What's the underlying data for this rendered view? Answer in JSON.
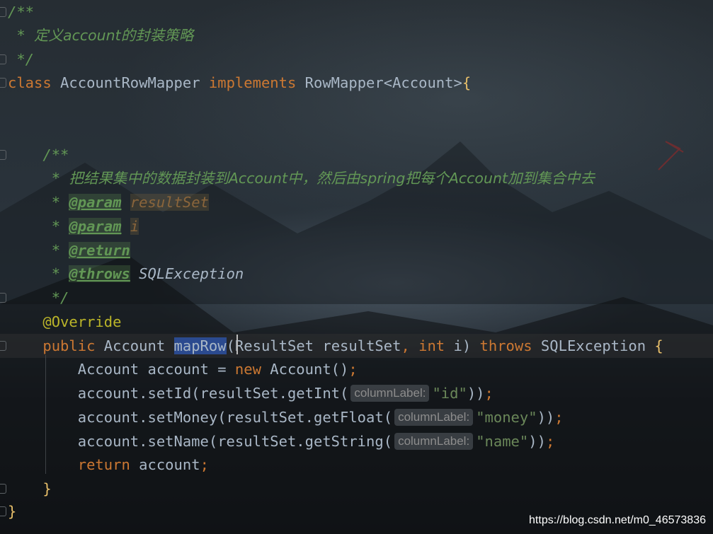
{
  "editor": {
    "lines": [
      {
        "id": "l1",
        "tokens": [
          {
            "t": "/**",
            "k": "c"
          }
        ]
      },
      {
        "id": "l2",
        "tokens": [
          {
            "t": " * ",
            "k": "c"
          },
          {
            "t": "定义account的封装策略",
            "k": "cn"
          }
        ]
      },
      {
        "id": "l3",
        "tokens": [
          {
            "t": " */",
            "k": "c"
          }
        ]
      },
      {
        "id": "l4",
        "tokens": [
          {
            "t": "class",
            "k": "kw"
          },
          {
            "t": " AccountRowMapper ",
            "k": ""
          },
          {
            "t": "implements",
            "k": "kw"
          },
          {
            "t": " RowMapper<Account>",
            "k": ""
          },
          {
            "t": "{",
            "k": "br"
          }
        ]
      },
      {
        "id": "l5",
        "tokens": []
      },
      {
        "id": "l6",
        "tokens": []
      },
      {
        "id": "l7",
        "tokens": [
          {
            "t": "    /**",
            "k": "c"
          }
        ]
      },
      {
        "id": "l8",
        "tokens": [
          {
            "t": "     * ",
            "k": "c"
          },
          {
            "t": "把结果集中的数据封装到Account中，然后由spring把每个Account加到集合中去",
            "k": "cn"
          }
        ]
      },
      {
        "id": "l9",
        "tokens": [
          {
            "t": "     * ",
            "k": "c"
          },
          {
            "t": "@param",
            "k": "tag"
          },
          {
            "t": " ",
            "k": "c"
          },
          {
            "t": "resultSet",
            "k": "pname"
          }
        ]
      },
      {
        "id": "l10",
        "tokens": [
          {
            "t": "     * ",
            "k": "c"
          },
          {
            "t": "@param",
            "k": "tag"
          },
          {
            "t": " ",
            "k": "c"
          },
          {
            "t": "i",
            "k": "pname"
          }
        ]
      },
      {
        "id": "l11",
        "tokens": [
          {
            "t": "     * ",
            "k": "c"
          },
          {
            "t": "@return",
            "k": "tag"
          }
        ]
      },
      {
        "id": "l12",
        "tokens": [
          {
            "t": "     * ",
            "k": "c"
          },
          {
            "t": "@throws",
            "k": "tag"
          },
          {
            "t": " SQLException",
            "k": "exc"
          }
        ]
      },
      {
        "id": "l13",
        "tokens": [
          {
            "t": "     */",
            "k": "c"
          }
        ]
      },
      {
        "id": "l14",
        "tokens": [
          {
            "t": "    ",
            "k": ""
          },
          {
            "t": "@Override",
            "k": "ann"
          }
        ]
      },
      {
        "id": "l15",
        "tokens": [
          {
            "t": "    ",
            "k": ""
          },
          {
            "t": "public",
            "k": "kw"
          },
          {
            "t": " Account ",
            "k": ""
          },
          {
            "t": "mapRow",
            "k": "hl"
          },
          {
            "t": "(ResultSet resultSet",
            "k": ""
          },
          {
            "t": ", ",
            "k": "kw"
          },
          {
            "t": "int",
            "k": "kw"
          },
          {
            "t": " i) ",
            "k": ""
          },
          {
            "t": "throws",
            "k": "kw"
          },
          {
            "t": " SQLException ",
            "k": ""
          },
          {
            "t": "{",
            "k": "br"
          }
        ]
      },
      {
        "id": "l16",
        "tokens": [
          {
            "t": "        Account account = ",
            "k": ""
          },
          {
            "t": "new",
            "k": "kw"
          },
          {
            "t": " Account()",
            "k": ""
          },
          {
            "t": ";",
            "k": "kw"
          }
        ]
      },
      {
        "id": "l17",
        "tokens": [
          {
            "t": "        account.setId(resultSet.getInt(",
            "k": ""
          },
          {
            "t": "columnLabel:",
            "k": "hint"
          },
          {
            "t": "\"id\"",
            "k": "str"
          },
          {
            "t": "))",
            "k": ""
          },
          {
            "t": ";",
            "k": "kw"
          }
        ]
      },
      {
        "id": "l18",
        "tokens": [
          {
            "t": "        account.setMoney(resultSet.getFloat(",
            "k": ""
          },
          {
            "t": "columnLabel:",
            "k": "hint"
          },
          {
            "t": "\"money\"",
            "k": "str"
          },
          {
            "t": "))",
            "k": ""
          },
          {
            "t": ";",
            "k": "kw"
          }
        ]
      },
      {
        "id": "l19",
        "tokens": [
          {
            "t": "        account.setName(resultSet.getString(",
            "k": ""
          },
          {
            "t": "columnLabel:",
            "k": "hint"
          },
          {
            "t": "\"name\"",
            "k": "str"
          },
          {
            "t": "))",
            "k": ""
          },
          {
            "t": ";",
            "k": "kw"
          }
        ]
      },
      {
        "id": "l20",
        "tokens": [
          {
            "t": "        ",
            "k": ""
          },
          {
            "t": "return",
            "k": "kw"
          },
          {
            "t": " account",
            "k": ""
          },
          {
            "t": ";",
            "k": "kw"
          }
        ]
      },
      {
        "id": "l21",
        "tokens": [
          {
            "t": "    ",
            "k": ""
          },
          {
            "t": "}",
            "k": "br"
          }
        ]
      },
      {
        "id": "l22",
        "tokens": [
          {
            "t": "}",
            "k": "br"
          }
        ]
      }
    ]
  },
  "watermark": "https://blog.csdn.net/m0_46573836"
}
